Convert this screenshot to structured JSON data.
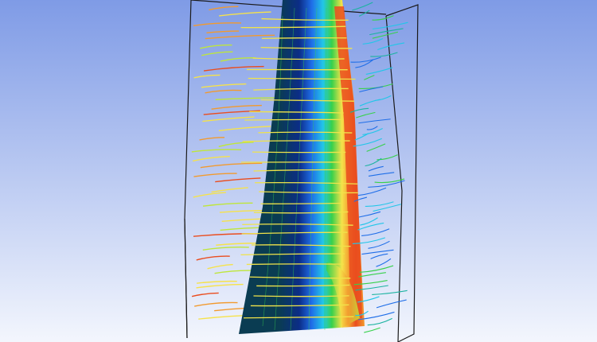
{
  "scene": {
    "subject": "cfd-turbine-blade-visualization",
    "background_top": "#7f9be6",
    "background_bottom": "#f3f6fd",
    "frame_color": "#1b1b1b",
    "palette": {
      "deep_blue": "#0b2d87",
      "navy": "#133b66",
      "dark_teal": "#0a3c52",
      "blue": "#1f6ee8",
      "cyan": "#22c6e8",
      "teal": "#1bb3a0",
      "green": "#37d14b",
      "yellow_green": "#bfe63b",
      "yellow": "#f6e24a",
      "orange": "#f29a2e",
      "red_orange": "#ea4d1f"
    },
    "streamline_color": "#f0e34a"
  }
}
